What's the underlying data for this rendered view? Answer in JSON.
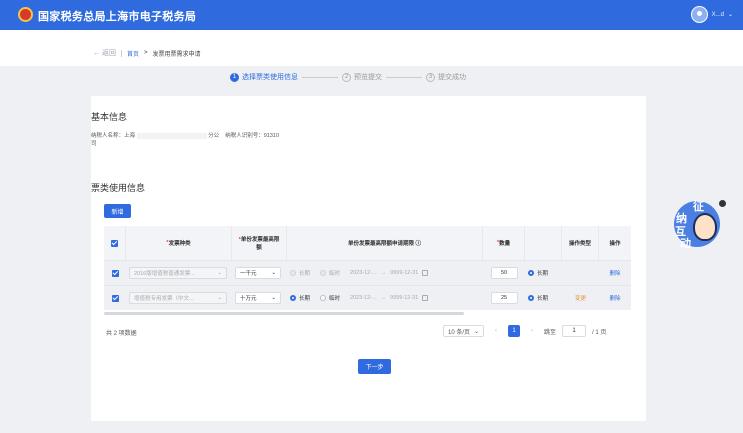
{
  "app": {
    "title": "国家税务总局上海市电子税务局",
    "user_name": "X...d"
  },
  "crumb": {
    "back": "返回",
    "home": "首页",
    "separator": ">",
    "current": "发票用票需求申请"
  },
  "steps": [
    {
      "num": "1",
      "label": "选择票类使用信息"
    },
    {
      "num": "2",
      "label": "预览提交"
    },
    {
      "num": "3",
      "label": "提交成功"
    }
  ],
  "basic": {
    "title": "基本信息",
    "taxpayer_name_label": "纳税人名称：",
    "taxpayer_name_value_a": "上海",
    "taxpayer_name_value_b": "分公",
    "taxpayer_name_value_c": "司",
    "taxpayer_id_label": "纳税人识别号：",
    "taxpayer_id_value": "91310"
  },
  "usage": {
    "title": "票类使用信息",
    "add_button": "新增"
  },
  "table": {
    "headers": {
      "type": "发票种类",
      "max_amount": "单份发票最高限额",
      "period": "单份发票最高限额申请期限",
      "qty": "数量",
      "op_type": "操作类型",
      "op": "操作"
    },
    "rows": [
      {
        "type": "2016版增值税普通发票...",
        "amount": "一千元",
        "opt_long": "长期",
        "opt_temp": "临时",
        "date_start": "2023-12-...",
        "date_end": "9999-12-31",
        "qty": "50",
        "qty_mode": "长期",
        "op_type": "",
        "op": "删除"
      },
      {
        "type": "增值税专用发票（中文...",
        "amount": "十万元",
        "opt_long": "长期",
        "opt_temp": "临时",
        "date_start": "2023-12-...",
        "date_end": "9999-12-31",
        "qty": "25",
        "qty_mode": "长期",
        "op_type": "变更",
        "op": "删除"
      }
    ]
  },
  "pagination": {
    "total": "共 2 项数据",
    "page_size": "10 条/页",
    "current": "1",
    "jump_label": "跳至",
    "jump_value": "1",
    "page_total": "/ 1 页"
  },
  "next_button": "下一步",
  "mascot": {
    "c1": "征",
    "c2": "纳",
    "c3": "互",
    "c4": "动"
  },
  "colors": {
    "primary": "#2f6bde",
    "danger": "#e23c3c"
  }
}
